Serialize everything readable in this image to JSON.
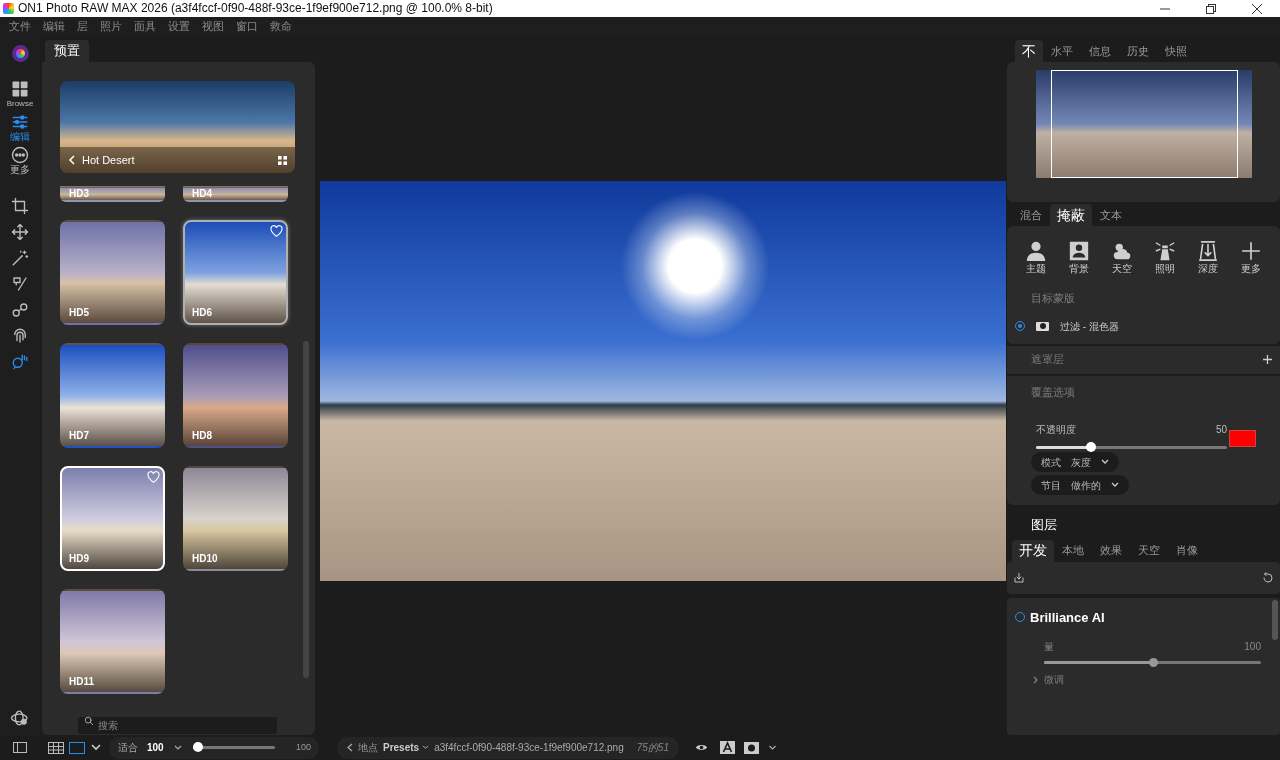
{
  "window": {
    "title": "ON1 Photo RAW MAX 2026 (a3f4fccf-0f90-488f-93ce-1f9ef900e712.png @ 100.0% 8-bit)"
  },
  "menu": [
    "文件",
    "编辑",
    "层",
    "照片",
    "面具",
    "设置",
    "视图",
    "窗口",
    "救命"
  ],
  "rail": {
    "modules": [
      {
        "label": "Browse",
        "selected": false
      },
      {
        "label": "编辑",
        "selected": true
      },
      {
        "label": "更多",
        "selected": false
      }
    ],
    "tools": [
      {
        "selected": false
      },
      {
        "selected": false
      },
      {
        "selected": false
      },
      {
        "selected": false
      },
      {
        "selected": false
      },
      {
        "selected": false
      },
      {
        "selected": true
      }
    ]
  },
  "presets_panel": {
    "tab": "预置",
    "category": "Hot Desert",
    "presets": [
      {
        "label": "HD3",
        "kind": "cut",
        "selected": false,
        "hovered": false
      },
      {
        "label": "HD4",
        "kind": "cut",
        "selected": false,
        "hovered": false
      },
      {
        "label": "HD5",
        "kind": "tile",
        "selected": false,
        "hovered": false
      },
      {
        "label": "HD6",
        "kind": "tile",
        "selected": false,
        "hovered": true
      },
      {
        "label": "HD7",
        "kind": "tile",
        "selected": false,
        "hovered": false
      },
      {
        "label": "HD8",
        "kind": "tile",
        "selected": false,
        "hovered": false
      },
      {
        "label": "HD9",
        "kind": "tile",
        "selected": true,
        "hovered": false
      },
      {
        "label": "HD10",
        "kind": "tile",
        "selected": false,
        "hovered": false
      },
      {
        "label": "HD11",
        "kind": "tile",
        "selected": false,
        "hovered": false
      }
    ],
    "search": {
      "placeholder": "搜索"
    }
  },
  "right_panel": {
    "nav_tabs": [
      {
        "label": "不",
        "selected": true
      },
      {
        "label": "水平",
        "selected": false
      },
      {
        "label": "信息",
        "selected": false
      },
      {
        "label": "历史",
        "selected": false
      },
      {
        "label": "快照",
        "selected": false
      }
    ],
    "mask_tabs": [
      {
        "label": "混合",
        "selected": false
      },
      {
        "label": "掩蔽",
        "selected": true
      },
      {
        "label": "文本",
        "selected": false
      }
    ],
    "mask_tools": [
      "主题",
      "背景",
      "天空",
      "照明",
      "深度",
      "更多"
    ],
    "target_heading": "目标蒙版",
    "target": {
      "label": "过滤 - 混色器",
      "selected": true
    },
    "mask_layers": "遮罩层",
    "overlay_heading": "覆盖选项",
    "opacity": {
      "label": "不透明度",
      "reading": "50",
      "level": 0.29,
      "color": "#ff0000"
    },
    "dropdowns": [
      {
        "label": "模式",
        "value": "灰度"
      },
      {
        "label": "节目",
        "value": "做作的"
      }
    ],
    "layers_heading": "图层",
    "dev_tabs": [
      {
        "label": "开发",
        "selected": true
      },
      {
        "label": "本地",
        "selected": false
      },
      {
        "label": "效果",
        "selected": false
      },
      {
        "label": "天空",
        "selected": false
      },
      {
        "label": "肖像",
        "selected": false
      }
    ],
    "filter": {
      "title": "Brilliance AI",
      "on": false,
      "amount_label": "量",
      "amount_reading": "100",
      "level": 0.5,
      "fine_tune": "微调",
      "expanded": false
    }
  },
  "bottom_bar": {
    "zoom_label": "适合",
    "zoom_value": "100",
    "zoom_slider": {
      "level": 0.07
    },
    "zoom_max": "100",
    "location_label": "地点",
    "folder": "Presets",
    "filename": "a3f4fccf-0f90-488f-93ce-1f9ef900e712.png",
    "count": "75的51"
  }
}
